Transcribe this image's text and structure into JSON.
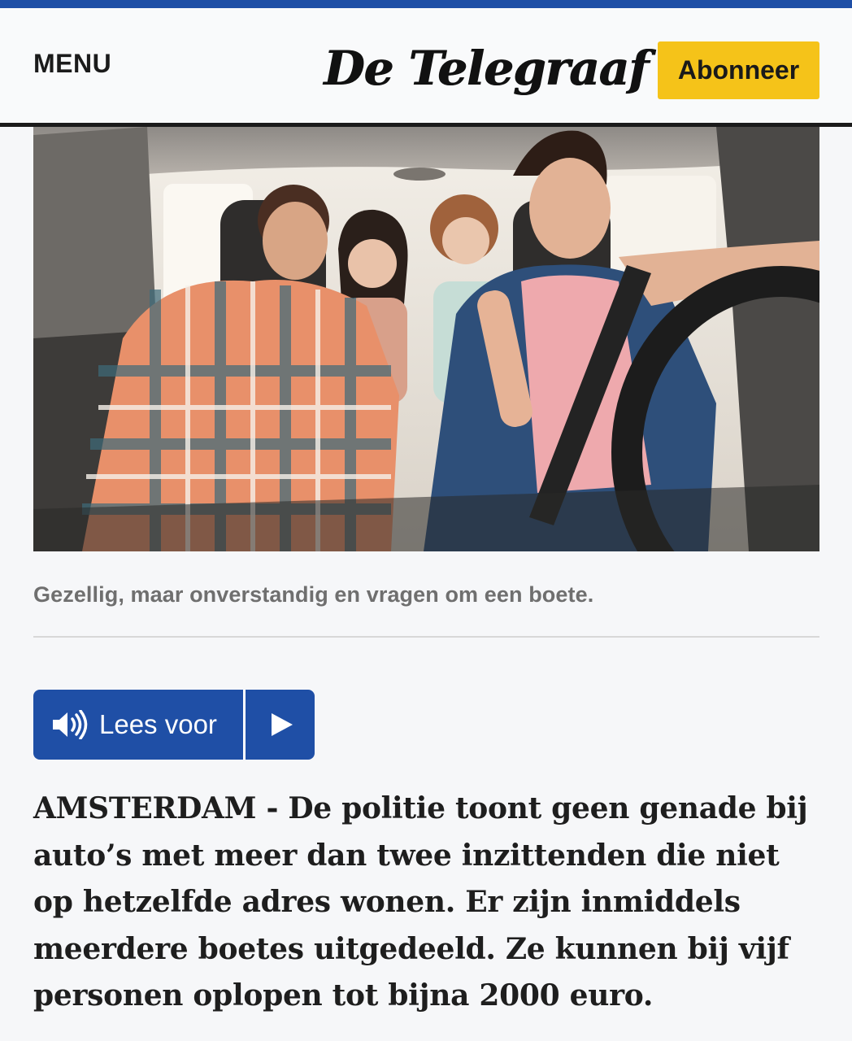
{
  "header": {
    "menu_label": "MENU",
    "logo_text": "De Telegraaf",
    "subscribe_label": "Abonneer",
    "brand_blue": "#1f4fa6",
    "subscribe_color": "#f5c319"
  },
  "hero": {
    "caption": "Gezellig, maar onverstandig en vragen om een boete."
  },
  "read_aloud": {
    "label": "Lees voor",
    "speaker_icon": "speaker-icon",
    "play_icon": "play-icon"
  },
  "article": {
    "lead": "AMSTERDAM - De politie toont geen genade bij auto’s met meer dan twee inzittenden die niet op hetzelfde adres wonen. Er zijn inmiddels meerdere boetes uitgedeeld. Ze kunnen bij vijf personen oplopen tot bijna 2000 euro."
  }
}
